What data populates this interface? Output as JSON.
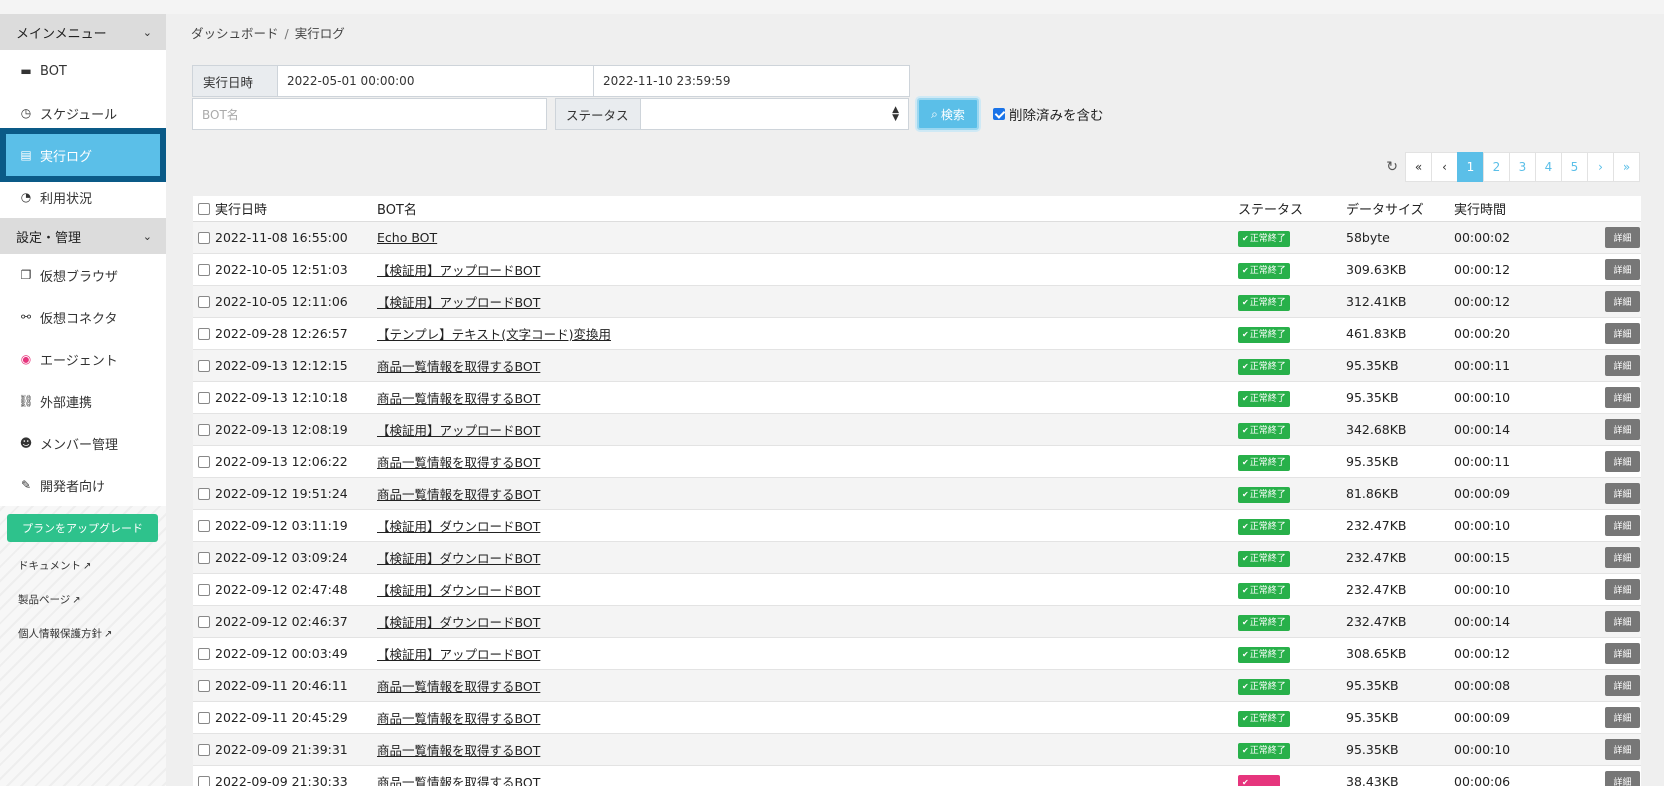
{
  "sidebar": {
    "main_menu_title": "メインメニュー",
    "main_items": [
      {
        "label": "BOT",
        "icon": "bot-icon"
      },
      {
        "label": "スケジュール",
        "icon": "clock-icon"
      },
      {
        "label": "実行ログ",
        "icon": "file-icon",
        "active": true
      },
      {
        "label": "利用状況",
        "icon": "pie-chart-icon"
      }
    ],
    "settings_title": "設定・管理",
    "settings_items": [
      {
        "label": "仮想ブラウザ",
        "icon": "browser-icon"
      },
      {
        "label": "仮想コネクタ",
        "icon": "connector-icon"
      },
      {
        "label": "エージェント",
        "icon": "agent-icon"
      },
      {
        "label": "外部連携",
        "icon": "link-icon"
      },
      {
        "label": "メンバー管理",
        "icon": "users-icon"
      },
      {
        "label": "開発者向け",
        "icon": "wrench-icon"
      }
    ],
    "upgrade_label": "プランをアップグレード",
    "links": [
      "ドキュメント",
      "製品ページ",
      "個人情報保護方針"
    ]
  },
  "breadcrumb": {
    "home": "ダッシュボード",
    "sep": "/",
    "current": "実行ログ"
  },
  "filters": {
    "date_label": "実行日時",
    "date_from": "2022-05-01 00:00:00",
    "date_to": "2022-11-10 23:59:59",
    "bot_placeholder": "BOT名",
    "status_label": "ステータス",
    "status_value": "",
    "search_label": "検索",
    "include_deleted_label": "削除済みを含む",
    "include_deleted": true
  },
  "pagination": {
    "first": "«",
    "prev": "‹",
    "pages": [
      "1",
      "2",
      "3",
      "4",
      "5"
    ],
    "current": "1",
    "next": "›",
    "last": "»"
  },
  "table": {
    "headers": {
      "date": "実行日時",
      "bot": "BOT名",
      "status": "ステータス",
      "size": "データサイズ",
      "time": "実行時間"
    },
    "detail_label": "詳細",
    "rows": [
      {
        "date": "2022-11-08 16:55:00",
        "bot": "Echo BOT",
        "status": "正常終了",
        "size": "58byte",
        "time": "00:00:02"
      },
      {
        "date": "2022-10-05 12:51:03",
        "bot": "【検証用】アップロードBOT",
        "status": "正常終了",
        "size": "309.63KB",
        "time": "00:00:12"
      },
      {
        "date": "2022-10-05 12:11:06",
        "bot": "【検証用】アップロードBOT",
        "status": "正常終了",
        "size": "312.41KB",
        "time": "00:00:12"
      },
      {
        "date": "2022-09-28 12:26:57",
        "bot": "【テンプレ】テキスト(文字コード)変換用",
        "status": "正常終了",
        "size": "461.83KB",
        "time": "00:00:20"
      },
      {
        "date": "2022-09-13 12:12:15",
        "bot": "商品一覧情報を取得するBOT",
        "status": "正常終了",
        "size": "95.35KB",
        "time": "00:00:11"
      },
      {
        "date": "2022-09-13 12:10:18",
        "bot": "商品一覧情報を取得するBOT",
        "status": "正常終了",
        "size": "95.35KB",
        "time": "00:00:10"
      },
      {
        "date": "2022-09-13 12:08:19",
        "bot": "【検証用】アップロードBOT",
        "status": "正常終了",
        "size": "342.68KB",
        "time": "00:00:14"
      },
      {
        "date": "2022-09-13 12:06:22",
        "bot": "商品一覧情報を取得するBOT",
        "status": "正常終了",
        "size": "95.35KB",
        "time": "00:00:11"
      },
      {
        "date": "2022-09-12 19:51:24",
        "bot": "商品一覧情報を取得するBOT",
        "status": "正常終了",
        "size": "81.86KB",
        "time": "00:00:09"
      },
      {
        "date": "2022-09-12 03:11:19",
        "bot": "【検証用】ダウンロードBOT",
        "status": "正常終了",
        "size": "232.47KB",
        "time": "00:00:10"
      },
      {
        "date": "2022-09-12 03:09:24",
        "bot": "【検証用】ダウンロードBOT",
        "status": "正常終了",
        "size": "232.47KB",
        "time": "00:00:15"
      },
      {
        "date": "2022-09-12 02:47:48",
        "bot": "【検証用】ダウンロードBOT",
        "status": "正常終了",
        "size": "232.47KB",
        "time": "00:00:10"
      },
      {
        "date": "2022-09-12 02:46:37",
        "bot": "【検証用】ダウンロードBOT",
        "status": "正常終了",
        "size": "232.47KB",
        "time": "00:00:14"
      },
      {
        "date": "2022-09-12 00:03:49",
        "bot": "【検証用】アップロードBOT",
        "status": "正常終了",
        "size": "308.65KB",
        "time": "00:00:12"
      },
      {
        "date": "2022-09-11 20:46:11",
        "bot": "商品一覧情報を取得するBOT",
        "status": "正常終了",
        "size": "95.35KB",
        "time": "00:00:08"
      },
      {
        "date": "2022-09-11 20:45:29",
        "bot": "商品一覧情報を取得するBOT",
        "status": "正常終了",
        "size": "95.35KB",
        "time": "00:00:09"
      },
      {
        "date": "2022-09-09 21:39:31",
        "bot": "商品一覧情報を取得するBOT",
        "status": "正常終了",
        "size": "95.35KB",
        "time": "00:00:10"
      },
      {
        "date": "2022-09-09 21:30:33",
        "bot": "商品一覧情報を取得するBOT",
        "status": "",
        "status_color": "#e6357d",
        "size": "38.43KB",
        "time": "00:00:06"
      }
    ]
  },
  "colors": {
    "accent": "#5bbfe8",
    "success": "#28b04a",
    "error": "#e6357d",
    "upgrade": "#2ec28c",
    "active_border": "#0a5a87"
  }
}
